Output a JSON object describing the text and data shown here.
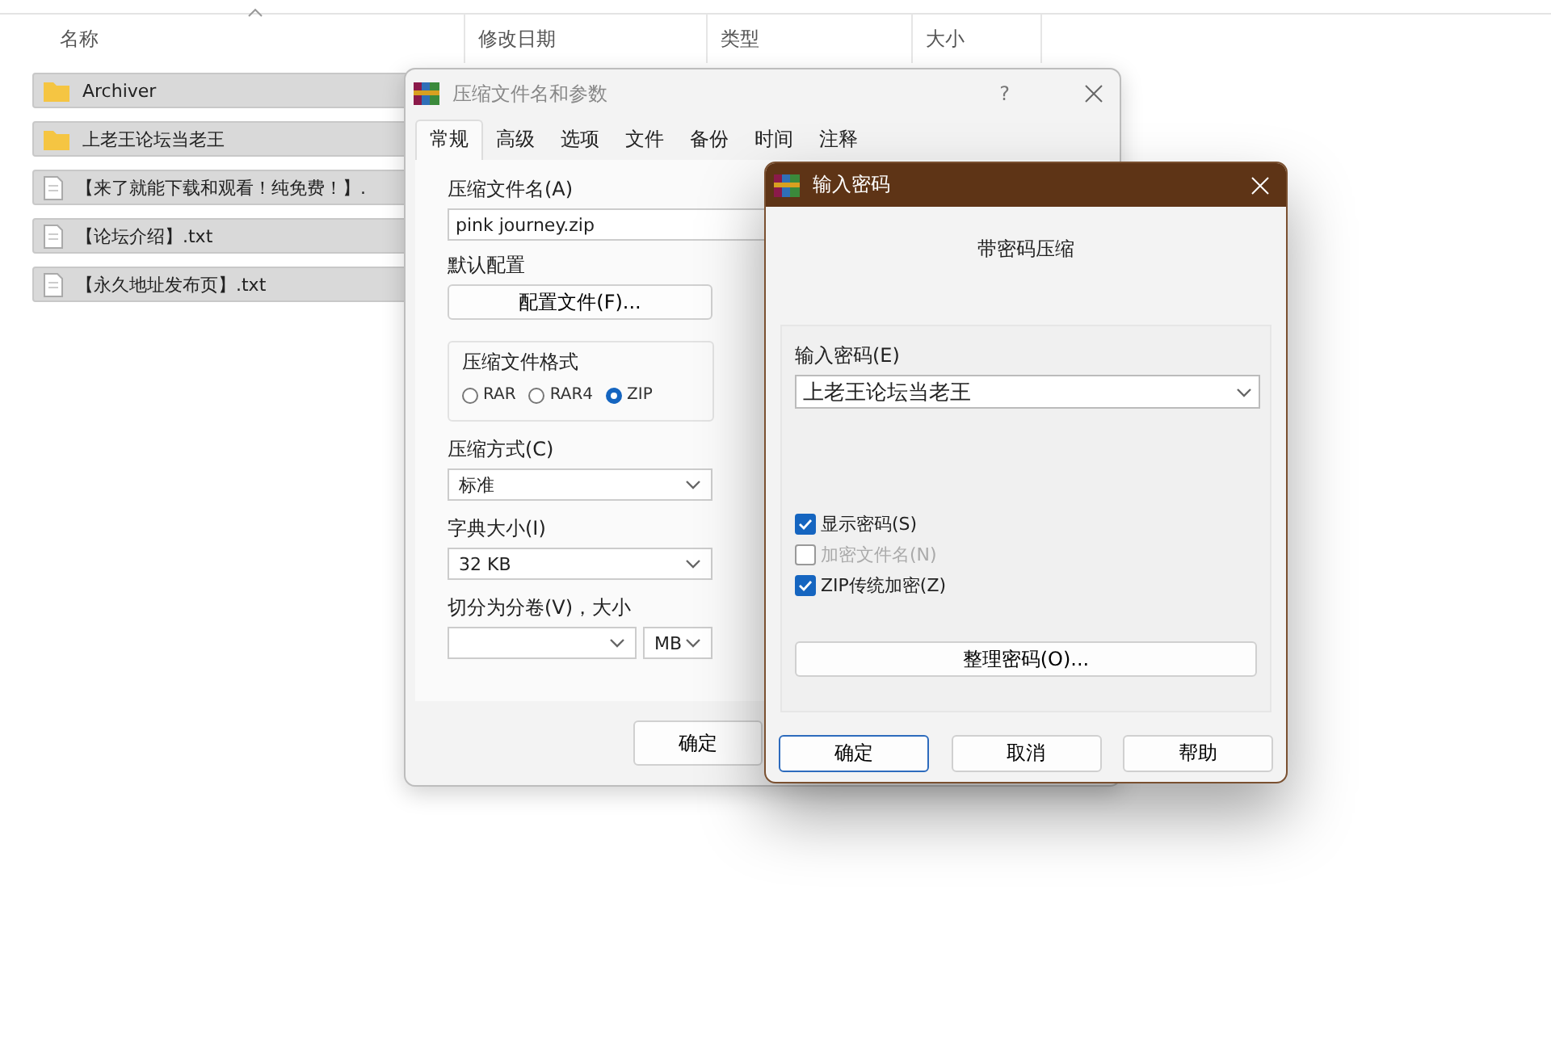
{
  "explorer": {
    "columns": [
      "名称",
      "修改日期",
      "类型",
      "大小"
    ],
    "rows": [
      {
        "name": "Archiver",
        "kind": "folder",
        "selected": true
      },
      {
        "name": "上老王论坛当老王",
        "kind": "folder",
        "selected": true
      },
      {
        "name": "【来了就能下载和观看！纯免费！】.",
        "kind": "file",
        "selected": true
      },
      {
        "name": "【论坛介绍】.txt",
        "kind": "file",
        "selected": true
      },
      {
        "name": "【永久地址发布页】.txt",
        "kind": "file",
        "selected": true
      }
    ]
  },
  "archive_dialog": {
    "title": "压缩文件名和参数",
    "help": "?",
    "tabs": [
      {
        "label": "常规",
        "selected": true
      },
      {
        "label": "高级",
        "selected": false
      },
      {
        "label": "选项",
        "selected": false
      },
      {
        "label": "文件",
        "selected": false
      },
      {
        "label": "备份",
        "selected": false
      },
      {
        "label": "时间",
        "selected": false
      },
      {
        "label": "注释",
        "selected": false
      }
    ],
    "archive_name_label": "压缩文件名(A)",
    "archive_name": "pink journey.zip",
    "profile_label": "默认配置",
    "profile_button": "配置文件(F)...",
    "format_group": "压缩文件格式",
    "formats": [
      {
        "label": "RAR",
        "selected": false
      },
      {
        "label": "RAR4",
        "selected": false
      },
      {
        "label": "ZIP",
        "selected": true
      }
    ],
    "method_label": "压缩方式(C)",
    "method": "标准",
    "dict_label": "字典大小(I)",
    "dict": "32 KB",
    "split_label": "切分为分卷(V)，大小",
    "split_unit": "MB",
    "ok_button": "确定"
  },
  "password_dialog": {
    "title": "输入密码",
    "heading": "带密码压缩",
    "password_label": "输入密码(E)",
    "password": "上老王论坛当老王",
    "options": [
      {
        "label": "显示密码(S)",
        "checked": true,
        "disabled": false
      },
      {
        "label": "加密文件名(N)",
        "checked": false,
        "disabled": true
      },
      {
        "label": "ZIP传统加密(Z)",
        "checked": true,
        "disabled": false
      }
    ],
    "manage_button": "整理密码(O)...",
    "buttons": [
      {
        "label": "确定",
        "selected": true
      },
      {
        "label": "取消",
        "selected": false
      },
      {
        "label": "帮助",
        "selected": false
      }
    ]
  }
}
